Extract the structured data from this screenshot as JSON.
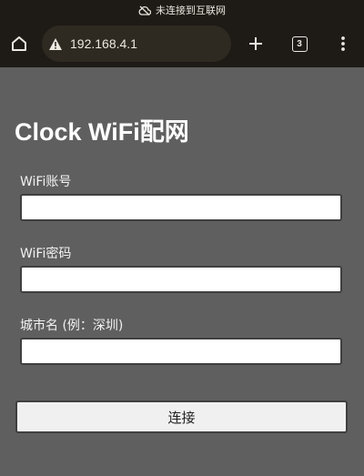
{
  "status_bar": {
    "network_text": "未连接到互联网",
    "icon": "cloud-off-icon"
  },
  "browser": {
    "url": "192.168.4.1",
    "tab_count": "3",
    "icons": {
      "home": "home-icon",
      "security": "warning-icon",
      "new_tab": "plus-icon",
      "menu": "more-vert-icon"
    }
  },
  "page": {
    "title": "Clock WiFi配网",
    "fields": [
      {
        "label": "WiFi账号",
        "value": "",
        "placeholder": ""
      },
      {
        "label": "WiFi密码",
        "value": "",
        "placeholder": ""
      },
      {
        "label": "城市名 (例：深圳)",
        "value": "",
        "placeholder": ""
      }
    ],
    "submit_label": "连接"
  },
  "colors": {
    "page_background": "#5f5f5f",
    "browser_chrome": "#1e1b16",
    "urlbar": "#2f2a21"
  }
}
